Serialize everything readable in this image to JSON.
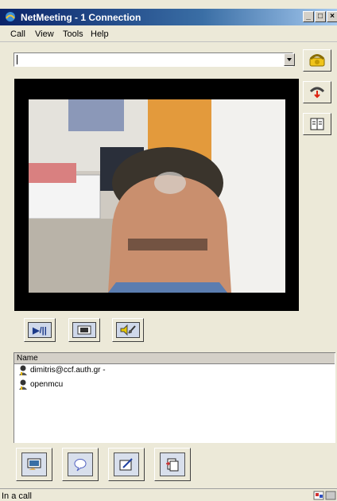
{
  "window": {
    "title": "NetMeeting - 1 Connection"
  },
  "menu": {
    "items": [
      "Call",
      "View",
      "Tools",
      "Help"
    ]
  },
  "address_bar": {
    "value": "",
    "placeholder": ""
  },
  "side_toolbar": [
    {
      "icon": "place-call-icon"
    },
    {
      "icon": "end-call-icon"
    },
    {
      "icon": "directory-icon"
    }
  ],
  "video_controls": [
    {
      "label": "▶/||",
      "icon": "play-pause-icon"
    },
    {
      "icon": "picture-in-picture-icon"
    },
    {
      "icon": "volume-settings-icon"
    }
  ],
  "participants": {
    "header": "Name",
    "rows": [
      "dimitris@ccf.auth.gr -",
      "openmcu"
    ]
  },
  "bottom_toolbar": [
    {
      "icon": "share-program-icon"
    },
    {
      "icon": "chat-icon"
    },
    {
      "icon": "whiteboard-icon"
    },
    {
      "icon": "file-transfer-icon"
    }
  ],
  "status": {
    "text": "In a call"
  },
  "colors": {
    "titlebar": "#0a246a",
    "face": "#ece9d8",
    "video_bg": "#000000"
  }
}
